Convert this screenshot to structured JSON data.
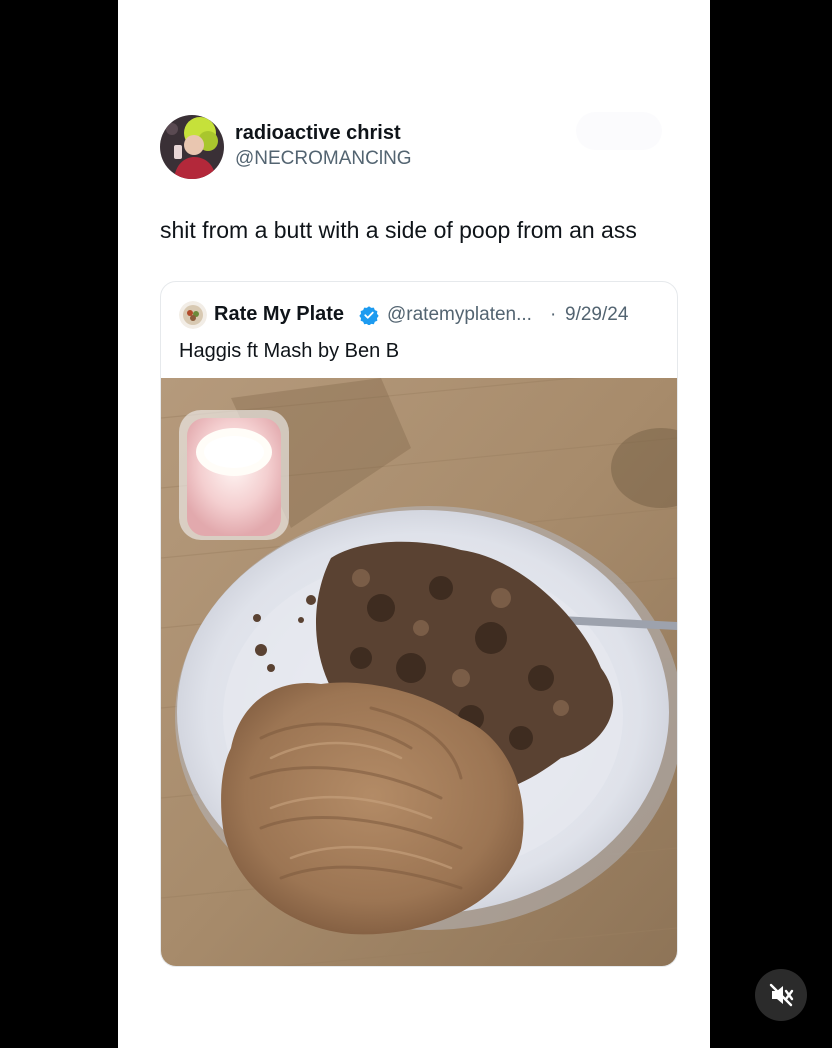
{
  "tweet": {
    "display_name": "radioactive christ",
    "handle": "@NECROMANClNG",
    "text": "shit from a butt with a side of poop from an ass"
  },
  "quoted_tweet": {
    "display_name": "Rate My Plate",
    "verified": true,
    "handle": "@ratemyplaten...",
    "separator": "·",
    "date": "9/29/24",
    "text": "Haggis ft Mash by Ben B",
    "photo_subject": "plate of haggis and mashed potatoes with a candle on a wooden table"
  },
  "controls": {
    "mute_icon": "speaker-muted-icon"
  },
  "colors": {
    "verified_badge": "#1d9bf0",
    "text_primary": "#0f1419",
    "text_secondary": "#536471",
    "border": "#e6e9ec"
  }
}
